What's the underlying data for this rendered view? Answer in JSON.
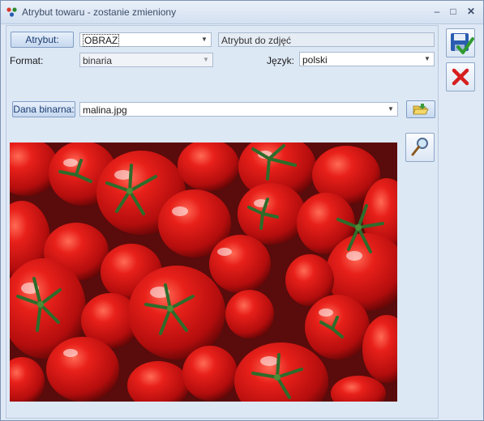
{
  "window": {
    "title": "Atrybut towaru - zostanie zmieniony"
  },
  "attribute": {
    "button_label": "Atrybut:",
    "value": "OBRAZ",
    "description": "Atrybut do zdjęć"
  },
  "format": {
    "label": "Format:",
    "value": "binaria"
  },
  "language": {
    "label": "Język:",
    "value": "polski"
  },
  "binary": {
    "button_label": "Dana binarna:",
    "file": "malina.jpg"
  },
  "colors": {
    "accent": "#1b3c72",
    "window_bg": "#dde8f5",
    "title_text": "#3b4b66",
    "cancel_red": "#d61f1f",
    "save_blue": "#2a5db0"
  },
  "icons": {
    "app": "attribute-icon",
    "save": "save-icon",
    "cancel": "cancel-icon",
    "open_folder": "folder-open-icon",
    "preview": "magnifier-icon"
  }
}
